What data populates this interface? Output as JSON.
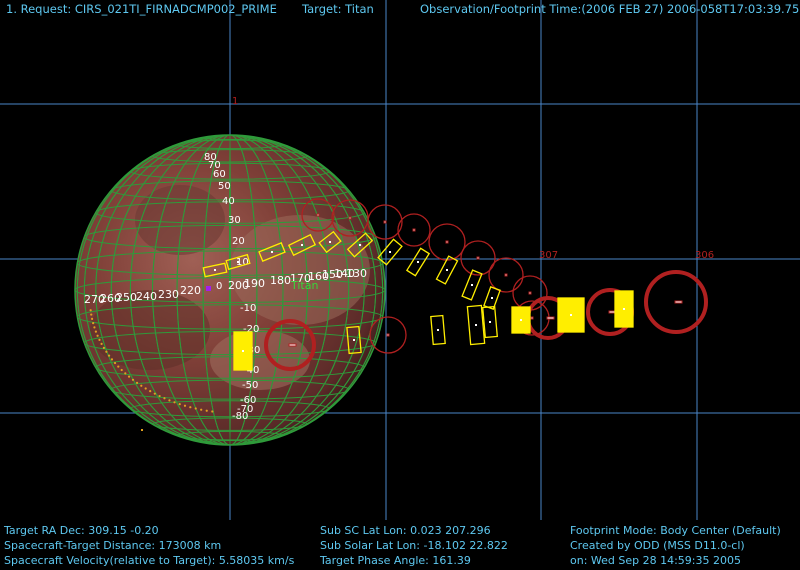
{
  "header": {
    "request": "1. Request: CIRS_021TI_FIRNADCMP002_PRIME",
    "target": "Target: Titan",
    "time": "Observation/Footprint Time:(2006 FEB 27) 2006-058T17:03:39.75"
  },
  "grid": {
    "dec_label": "1",
    "ra_labels": [
      "307",
      "306"
    ],
    "body_name": "Titan"
  },
  "latitude_labels": [
    "80",
    "70",
    "60",
    "50",
    "40",
    "30",
    "20",
    "10",
    "0",
    "-10",
    "-20",
    "-30",
    "-40",
    "-50",
    "-60",
    "-70",
    "-80"
  ],
  "longitude_labels": [
    "0",
    "200",
    "190",
    "180",
    "170",
    "160",
    "150",
    "140",
    "130",
    "230",
    "240",
    "250",
    "260",
    "270",
    "220"
  ],
  "footer": {
    "left": [
      "Target RA  Dec: 309.15   -0.20",
      "Spacecraft-Target Distance:  173008 km",
      "Spacecraft Velocity(relative to Target): 5.58035 km/s"
    ],
    "middle": [
      "Sub SC Lat Lon:  0.023  207.296",
      "Sub Solar Lat Lon: -18.102  22.822",
      "Target Phase Angle: 161.39"
    ],
    "right": [
      "Footprint Mode: Body Center (Default)",
      "Created by ODD (MSS D11.0-cl)",
      "on: Wed Sep 28 14:59:35 2005"
    ]
  },
  "colors": {
    "text": "#5ec8f0",
    "grid": "#4a86c8",
    "ring": "#b02020",
    "box": "#ffee00",
    "lat_lon_grid": "#2f9a3a",
    "planet": "#7a3a30"
  },
  "footprints": {
    "rings": [
      [
        318,
        215,
        16
      ],
      [
        350,
        218,
        18
      ],
      [
        385,
        222,
        17
      ],
      [
        414,
        230,
        16
      ],
      [
        447,
        242,
        18
      ],
      [
        478,
        258,
        17
      ],
      [
        506,
        275,
        17
      ],
      [
        530,
        293,
        17
      ],
      [
        388,
        335,
        18
      ],
      [
        290,
        345,
        24
      ],
      [
        532,
        318,
        17
      ],
      [
        548,
        318,
        20
      ],
      [
        610,
        312,
        22
      ],
      [
        676,
        302,
        30
      ]
    ],
    "boxes": [
      [
        215,
        270,
        22,
        9,
        -12
      ],
      [
        238,
        262,
        22,
        9,
        -16
      ],
      [
        272,
        252,
        24,
        10,
        -22
      ],
      [
        302,
        245,
        24,
        11,
        -26
      ],
      [
        330,
        242,
        18,
        12,
        -38
      ],
      [
        360,
        245,
        24,
        10,
        -42
      ],
      [
        390,
        252,
        24,
        11,
        -50
      ],
      [
        418,
        262,
        26,
        10,
        -58
      ],
      [
        447,
        270,
        26,
        10,
        -62
      ],
      [
        472,
        285,
        28,
        10,
        -68
      ],
      [
        492,
        298,
        20,
        10,
        -70
      ],
      [
        354,
        340,
        12,
        26,
        -5
      ],
      [
        438,
        330,
        12,
        28,
        -5
      ],
      [
        476,
        325,
        14,
        38,
        -5
      ],
      [
        490,
        322,
        12,
        30,
        -5
      ],
      [
        521,
        320,
        18,
        26,
        0
      ],
      [
        571,
        315,
        26,
        34,
        0
      ],
      [
        624,
        309,
        18,
        36,
        0
      ],
      [
        243,
        351,
        18,
        38,
        0
      ]
    ]
  }
}
